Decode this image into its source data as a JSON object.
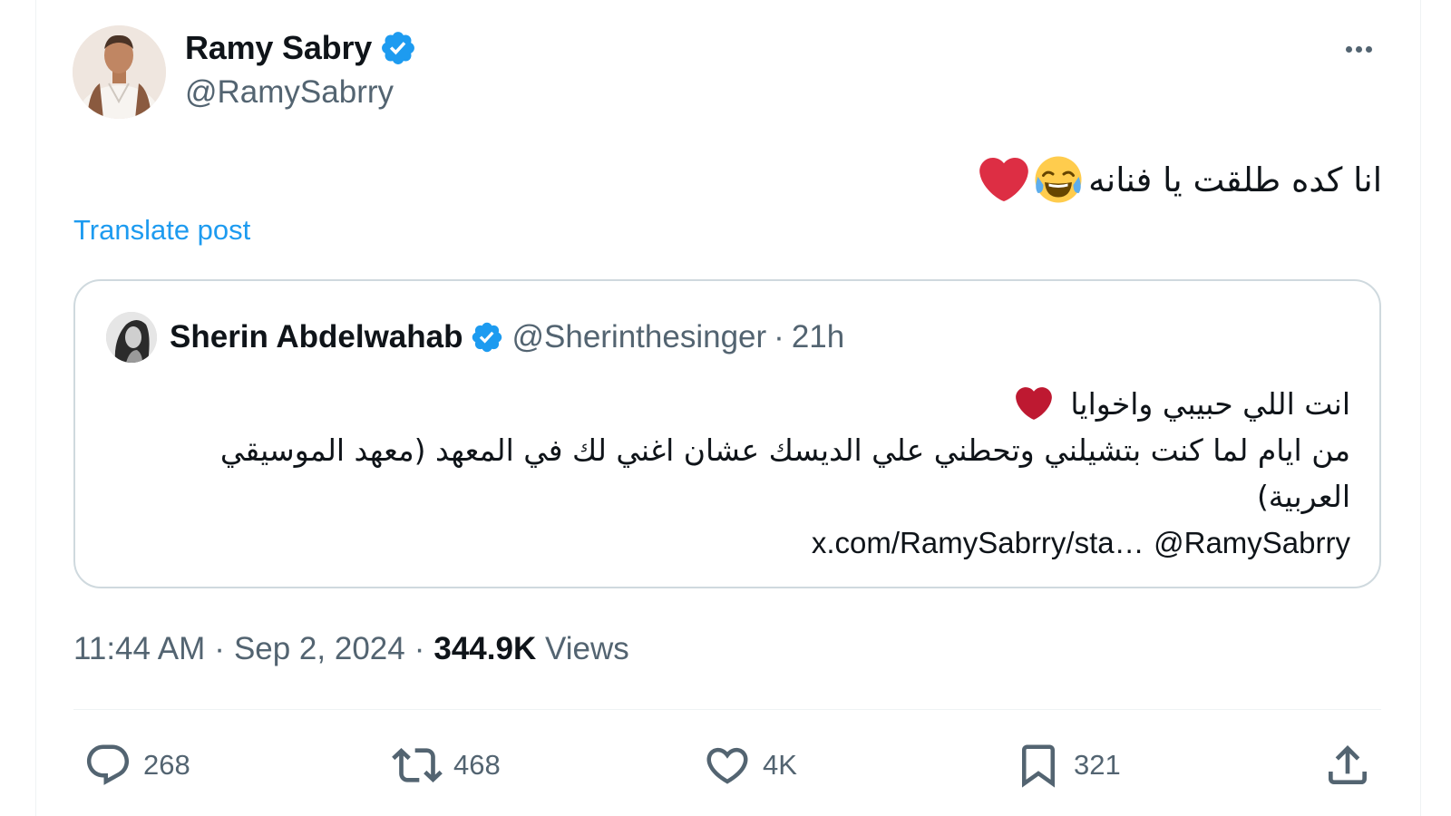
{
  "author": {
    "display_name": "Ramy Sabry",
    "handle": "@RamySabrry",
    "verified": true
  },
  "tweet": {
    "text": "انا كده طلقت يا فنانه",
    "emojis": [
      "face-with-tears-of-joy",
      "red-heart"
    ]
  },
  "translate_label": "Translate post",
  "quote": {
    "display_name": "Sherin Abdelwahab",
    "handle": "@Sherinthesinger",
    "separator": "·",
    "time": "21h",
    "line1": "انت اللي حبيبي واخوايا",
    "line2": "من ايام لما كنت بتشيلني وتحطني علي الديسك عشان اغني لك في المعهد (معهد الموسيقي العربية)",
    "mention": "@RamySabrry",
    "link": "x.com/RamySabrry/sta…"
  },
  "meta": {
    "time": "11:44 AM",
    "sep1": "·",
    "date": "Sep 2, 2024",
    "sep2": "·",
    "views_count": "344.9K",
    "views_label": "Views"
  },
  "actions": {
    "replies": "268",
    "reposts": "468",
    "likes": "4K",
    "bookmarks": "321"
  },
  "colors": {
    "accent": "#1d9bf0",
    "text_primary": "#0f1419",
    "text_secondary": "#536471",
    "border": "#cfd9de",
    "heart_red": "#dd2e44"
  }
}
